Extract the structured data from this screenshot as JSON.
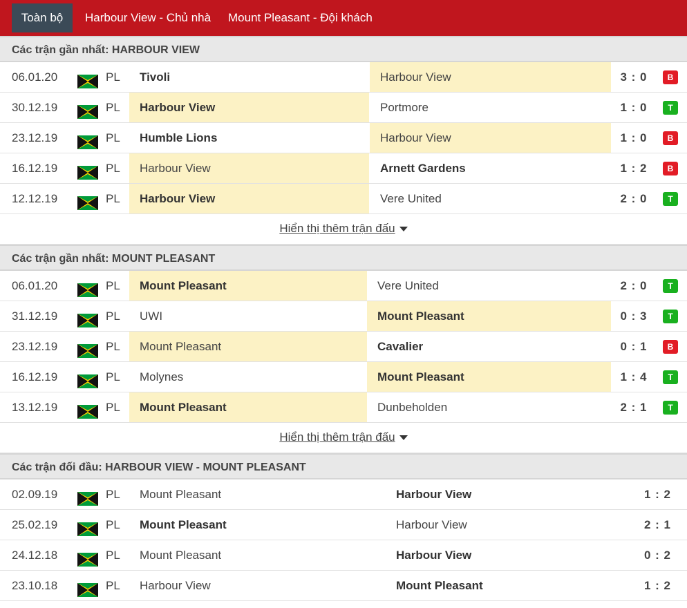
{
  "tabs": [
    "Toàn bộ",
    "Harbour View - Chủ nhà",
    "Mount Pleasant - Đội khách"
  ],
  "more_label": "Hiển thị thêm trận đấu",
  "sections": [
    {
      "title": "Các trận gần nhất: HARBOUR VIEW",
      "matches": [
        {
          "date": "06.01.20",
          "league": "PL",
          "home": "Tivoli",
          "away": "Harbour View",
          "score": "3 : 0",
          "result": "B",
          "winner": "home",
          "hl": "away"
        },
        {
          "date": "30.12.19",
          "league": "PL",
          "home": "Harbour View",
          "away": "Portmore",
          "score": "1 : 0",
          "result": "T",
          "winner": "home",
          "hl": "home"
        },
        {
          "date": "23.12.19",
          "league": "PL",
          "home": "Humble Lions",
          "away": "Harbour View",
          "score": "1 : 0",
          "result": "B",
          "winner": "home",
          "hl": "away"
        },
        {
          "date": "16.12.19",
          "league": "PL",
          "home": "Harbour View",
          "away": "Arnett Gardens",
          "score": "1 : 2",
          "result": "B",
          "winner": "away",
          "hl": "home"
        },
        {
          "date": "12.12.19",
          "league": "PL",
          "home": "Harbour View",
          "away": "Vere United",
          "score": "2 : 0",
          "result": "T",
          "winner": "home",
          "hl": "home"
        }
      ]
    },
    {
      "title": "Các trận gần nhất: MOUNT PLEASANT",
      "matches": [
        {
          "date": "06.01.20",
          "league": "PL",
          "home": "Mount Pleasant",
          "away": "Vere United",
          "score": "2 : 0",
          "result": "T",
          "winner": "home",
          "hl": "home"
        },
        {
          "date": "31.12.19",
          "league": "PL",
          "home": "UWI",
          "away": "Mount Pleasant",
          "score": "0 : 3",
          "result": "T",
          "winner": "away",
          "hl": "away"
        },
        {
          "date": "23.12.19",
          "league": "PL",
          "home": "Mount Pleasant",
          "away": "Cavalier",
          "score": "0 : 1",
          "result": "B",
          "winner": "away",
          "hl": "home"
        },
        {
          "date": "16.12.19",
          "league": "PL",
          "home": "Molynes",
          "away": "Mount Pleasant",
          "score": "1 : 4",
          "result": "T",
          "winner": "away",
          "hl": "away"
        },
        {
          "date": "13.12.19",
          "league": "PL",
          "home": "Mount Pleasant",
          "away": "Dunbeholden",
          "score": "2 : 1",
          "result": "T",
          "winner": "home",
          "hl": "home"
        }
      ]
    },
    {
      "title": "Các trận đối đầu: HARBOUR VIEW - MOUNT PLEASANT",
      "matches": [
        {
          "date": "02.09.19",
          "league": "PL",
          "home": "Mount Pleasant",
          "away": "Harbour View",
          "score": "1 : 2",
          "winner": "away"
        },
        {
          "date": "25.02.19",
          "league": "PL",
          "home": "Mount Pleasant",
          "away": "Harbour View",
          "score": "2 : 1",
          "winner": "home"
        },
        {
          "date": "24.12.18",
          "league": "PL",
          "home": "Mount Pleasant",
          "away": "Harbour View",
          "score": "0 : 2",
          "winner": "away"
        },
        {
          "date": "23.10.18",
          "league": "PL",
          "home": "Harbour View",
          "away": "Mount Pleasant",
          "score": "1 : 2",
          "winner": "away"
        }
      ]
    }
  ]
}
